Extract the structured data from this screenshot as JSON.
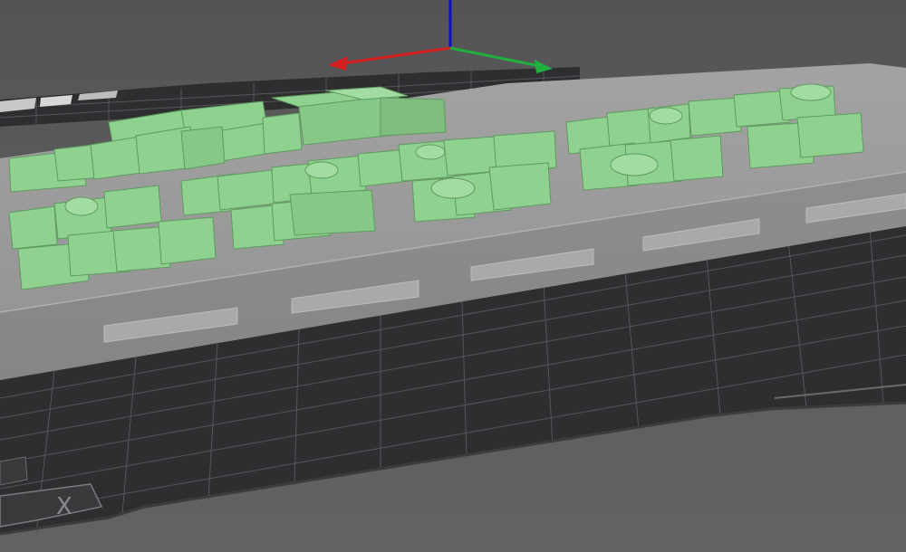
{
  "app": {
    "title": ""
  },
  "viewport": {
    "background_color": "#5a5a5c",
    "bed_color": "#2e2e31",
    "grid_line_color": "#55555a",
    "plate_color": "#9b9b9b",
    "model_color": "#8fd18f",
    "axes": {
      "x_axis_color": "#d42020",
      "y_axis_color": "#20b040",
      "z_axis_color": "#1010c8"
    },
    "bed_mark_label": "X",
    "icons": [
      "axis-gizmo-icon",
      "bed-corner-x-icon"
    ]
  }
}
